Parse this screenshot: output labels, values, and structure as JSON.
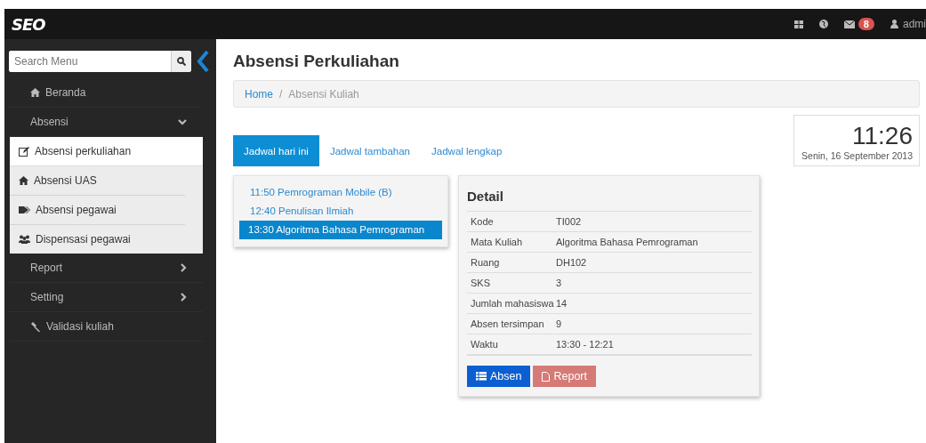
{
  "topbar": {
    "logo": "SEO",
    "mail_count": "8",
    "user": "admi"
  },
  "sidebar": {
    "search": {
      "placeholder": "Search Menu"
    },
    "menu": [
      {
        "label": "Beranda",
        "selected": false
      },
      {
        "label": "Absensi",
        "selected": false,
        "expanded": true,
        "children": [
          {
            "label": "Absensi perkuliahan",
            "selected": true
          },
          {
            "label": "Absensi UAS",
            "selected": false
          },
          {
            "label": "Absensi pegawai",
            "selected": false
          },
          {
            "label": "Dispensasi pegawai",
            "selected": false
          }
        ]
      },
      {
        "label": "Report",
        "selected": false,
        "expanded": false
      },
      {
        "label": "Setting",
        "selected": false,
        "expanded": false
      },
      {
        "label": "Validasi kuliah",
        "selected": false
      }
    ]
  },
  "page": {
    "title": "Absensi Perkuliahan",
    "breadcrumb_separator": "/",
    "breadcrumb": [
      {
        "label": "Home",
        "kind": "link"
      },
      {
        "label": "Absensi Kuliah",
        "kind": "current"
      }
    ],
    "clock": {
      "time": "11:26",
      "date": "Senin, 16 September 2013"
    },
    "tabs": [
      {
        "label": "Jadwal hari ini",
        "selected": true
      },
      {
        "label": "Jadwal tambahan",
        "selected": false
      },
      {
        "label": "Jadwal lengkap",
        "selected": false
      }
    ],
    "schedule": [
      {
        "label": "11:50 Pemrograman Mobile (B)",
        "selected": false
      },
      {
        "label": "12:40 Penulisan Ilmiah",
        "selected": false
      },
      {
        "label": "13:30 Algoritma Bahasa Pemrograman",
        "selected": true
      }
    ],
    "detail": {
      "title": "Detail",
      "rows": [
        {
          "label": "Kode",
          "value": "TI002"
        },
        {
          "label": "Mata Kuliah",
          "value": "Algoritma Bahasa Pemrograman"
        },
        {
          "label": "Ruang",
          "value": "DH102"
        },
        {
          "label": "SKS",
          "value": "3"
        },
        {
          "label": "Jumlah mahasiswa",
          "value": "14"
        },
        {
          "label": "Absen tersimpan",
          "value": "9"
        },
        {
          "label": "Waktu",
          "value": "13:30 - 12:21"
        }
      ],
      "buttons": [
        {
          "label": "Absen",
          "kind": "primary"
        },
        {
          "label": "Report",
          "kind": "danger"
        }
      ]
    }
  }
}
